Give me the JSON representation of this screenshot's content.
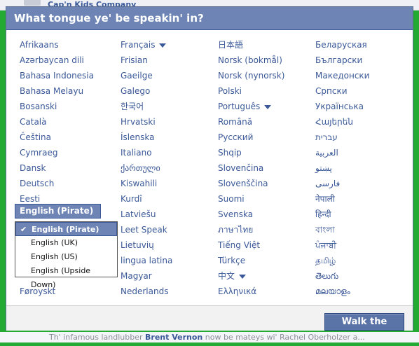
{
  "background": {
    "top_text": "Cap'n Kids Company",
    "bottom_text_pre": "Th' infamous landlubber ",
    "bottom_name": "Brent Vernon",
    "bottom_text_post": " now be mateys wi' Rachel Oberholzer a..."
  },
  "dialog": {
    "title": "What tongue ye' be speakin' in?",
    "columns": [
      [
        "Afrikaans",
        "Azərbaycan dili",
        "Bahasa Indonesia",
        "Bahasa Melayu",
        "Bosanski",
        "Català",
        "Čeština",
        "Cymraeg",
        "Dansk",
        "Deutsch",
        "Eesti"
      ],
      [
        "Français",
        "Frisian",
        "Gaeilge",
        "Galego",
        "한국어",
        "Hrvatski",
        "Íslenska",
        "Italiano",
        "ქართული",
        "Kiswahili",
        "Kurdî",
        "Latviešu",
        "Leet Speak",
        "Lietuvių",
        "lingua latina",
        "Magyar",
        "Nederlands"
      ],
      [
        "日本語",
        "Norsk (bokmål)",
        "Norsk (nynorsk)",
        "Polski",
        "Português",
        "Română",
        "Русский",
        "Shqip",
        "Slovenčina",
        "Slovenščina",
        "Suomi",
        "Svenska",
        "ภาษาไทย",
        "Tiếng Việt",
        "Türkçe",
        "中文",
        "Ελληνικά"
      ],
      [
        "Беларуская",
        "Български",
        "Македонски",
        "Српски",
        "Українська",
        "Հայերեն",
        "עברית",
        "العربية",
        "پښتو",
        "فارسی",
        "नेपाली",
        "हिन्दी",
        "বাংলা",
        "ਪੰਜਾਬੀ",
        "தமிழ்",
        "తెలుగు",
        "മലയാളം"
      ]
    ],
    "col1_last": "Føroyskt",
    "english_select": {
      "selected": "English (Pirate)",
      "options": [
        "English (Pirate)",
        "English (UK)",
        "English (US)",
        "English (Upside Down)"
      ]
    },
    "walk_button": "Walk the plank!"
  },
  "colors": {
    "accent": "#6d84b4",
    "link": "#3b5998",
    "border_green": "#22aa33"
  }
}
